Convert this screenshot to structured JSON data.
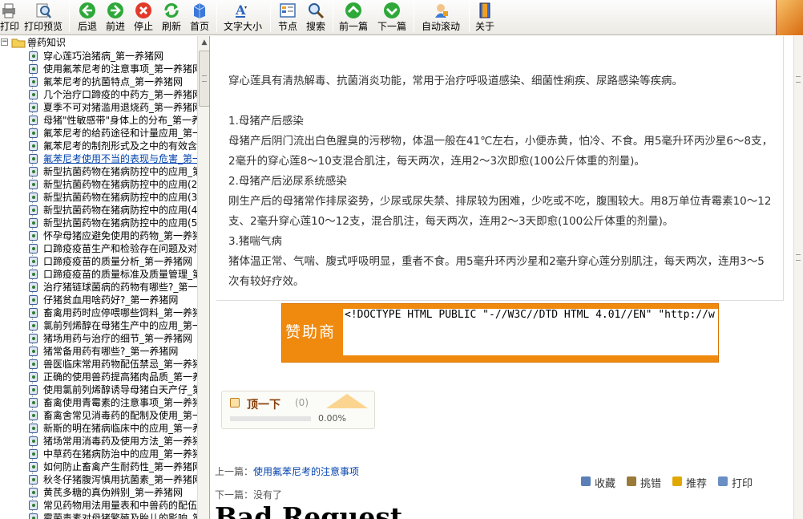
{
  "toolbar": {
    "items": [
      {
        "label": "打印",
        "icon": "printer-icon"
      },
      {
        "label": "打印预览",
        "icon": "print-preview-icon"
      },
      {
        "label": "后退",
        "icon": "back-arrow-icon"
      },
      {
        "label": "前进",
        "icon": "forward-arrow-icon"
      },
      {
        "label": "停止",
        "icon": "stop-icon"
      },
      {
        "label": "刷新",
        "icon": "refresh-icon"
      },
      {
        "label": "首页",
        "icon": "home-icon"
      },
      {
        "label": "文字大小",
        "icon": "text-size-icon"
      },
      {
        "label": "节点",
        "icon": "node-icon"
      },
      {
        "label": "搜索",
        "icon": "search-icon"
      },
      {
        "label": "前一篇",
        "icon": "prev-article-icon"
      },
      {
        "label": "下一篇",
        "icon": "next-article-icon"
      },
      {
        "label": "自动滚动",
        "icon": "auto-scroll-icon"
      },
      {
        "label": "关于",
        "icon": "about-icon"
      }
    ]
  },
  "tree": {
    "root_label": "兽药知识",
    "items": [
      "穿心莲巧治猪病_第一养猪网",
      "使用氟苯尼考的注意事项_第一养猪网",
      "氟苯尼考的抗菌特点_第一养猪网",
      "几个治疗口蹄疫的中药方_第一养猪网",
      "夏季不可对猪滥用退烧药_第一养猪网",
      "母猪\"性敏感带\"身体上的分布_第一养猪网",
      "氟苯尼考的给药途径和计量应用_第一养猪网",
      "氟苯尼考的制剂形式及之中的有效含量",
      "氟苯尼考使用不当的表现与危害_第一养猪网",
      "新型抗菌药物在猪病防控中的应用_第一养猪网",
      "新型抗菌药物在猪病防控中的应用(2)",
      "新型抗菌药物在猪病防控中的应用(3)",
      "新型抗菌药物在猪病防控中的应用(4)",
      "新型抗菌药物在猪病防控中的应用(5)",
      "怀孕母猪应避免使用的药物_第一养猪网",
      "口蹄疫疫苗生产和检验存在问题及对策",
      "口蹄疫疫苗的质量分析_第一养猪网",
      "口蹄疫疫苗的质量标准及质量管理_第一养猪网",
      "治疗猪链球菌病的药物有哪些?_第一养猪网",
      "仔猪贫血用啥药好?_第一养猪网",
      "畜禽用药时应停喂哪些饲料_第一养猪网",
      "氯前列烯醇在母猪生产中的应用_第一养猪网",
      "猪场用药与治疗的细节_第一养猪网",
      "猪常备用药有哪些?_第一养猪网",
      "兽医临床常用药物配伍禁忌_第一养猪网",
      "正确的使用兽药提高猪肉品质_第一养猪网",
      "使用氯前列烯醇诱导母猪白天产仔_第一养猪网",
      "畜禽使用青霉素的注意事项_第一养猪网",
      "畜禽舍常见消毒药的配制及使用_第一养猪网",
      "新斯的明在猪病临床中的应用_第一养猪网",
      "猪场常用消毒药及使用方法_第一养猪网",
      "中草药在猪病防治中的应用_第一养猪网",
      "如何防止畜禽产生耐药性_第一养猪网",
      "秋冬仔猪腹泻慎用抗菌素_第一养猪网",
      "黄芪多糖的真伪辨别_第一养猪网",
      "常见药物用法用量表和中兽药的配伍",
      "霉菌毒素对母猪繁殖及胎儿的影响_第一养猪网"
    ],
    "selected_index": 8
  },
  "article": {
    "paragraphs": [
      "穿心莲具有清热解毒、抗菌消炎功能，常用于治疗呼吸道感染、细菌性痢疾、尿路感染等疾病。",
      "1.母猪产后感染",
      "母猪产后阴门流出白色腥臭的污秽物，体温一般在41℃左右，小便赤黄，怕冷、不食。用5毫升环丙沙星6～8支，2毫升的穿心莲8～10支混合肌注，每天两次，连用2～3次即愈(100公斤体重的剂量)。",
      "2.母猪产后泌尿系统感染",
      "刚生产后的母猪常作排尿姿势，少尿或尿失禁、排尿较为困难，少吃或不吃，腹围较大。用8万单位青霉素10～12支、2毫升穿心莲10～12支，混合肌注，每天两次，连用2～3天即愈(100公斤体重的剂量)。",
      "3.猪喘气病",
      "猪体温正常、气喘、腹式呼吸明显，重者不食。用5毫升环丙沙星和2毫升穿心莲分别肌注，每天两次，连用3～5次有较好疗效。"
    ]
  },
  "sponsor": {
    "label": "赞助商",
    "code": "<!DOCTYPE HTML PUBLIC \"-//W3C//DTD HTML 4.01//EN\" \"http://w"
  },
  "dig": {
    "label": "顶一下",
    "count": "(0)",
    "percent": "0.00%",
    "fill_fraction": 0
  },
  "nav": {
    "prev_label": "上一篇：",
    "prev_link": "使用氟苯尼考的注意事项",
    "next_label": "下一篇：没有了"
  },
  "actions": [
    {
      "label": "收藏",
      "icon": "favorite-icon",
      "color": "#5b7fb6"
    },
    {
      "label": "挑错",
      "icon": "wrench-icon",
      "color": "#9a7a38"
    },
    {
      "label": "推荐",
      "icon": "star-icon",
      "color": "#e0a800"
    },
    {
      "label": "打印",
      "icon": "print-icon",
      "color": "#6a8fc4"
    }
  ],
  "error_text": "Bad Request"
}
